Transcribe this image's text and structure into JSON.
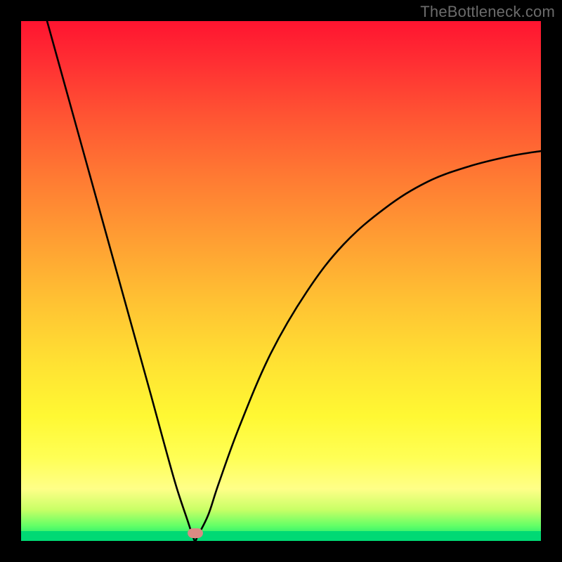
{
  "watermark": {
    "text": "TheBottleneck.com"
  },
  "chart_data": {
    "type": "line",
    "title": "",
    "xlabel": "",
    "ylabel": "",
    "xlim": [
      0,
      100
    ],
    "ylim": [
      0,
      100
    ],
    "grid": false,
    "legend": false,
    "series": [
      {
        "name": "bottleneck-curve",
        "x": [
          5,
          10,
          15,
          20,
          25,
          28,
          30,
          32,
          33,
          33.5,
          34,
          36,
          38,
          42,
          48,
          55,
          62,
          70,
          78,
          86,
          94,
          100
        ],
        "values": [
          100,
          82,
          64,
          46,
          28,
          17,
          10,
          4,
          1,
          0,
          1,
          5,
          11,
          22,
          36,
          48,
          57,
          64,
          69,
          72,
          74,
          75
        ]
      }
    ],
    "annotations": [
      {
        "name": "optimal-point",
        "x": 33.5,
        "y": 1.5,
        "shape": "pill",
        "color": "#d98b84"
      }
    ],
    "background_gradient": {
      "direction": "vertical",
      "stops": [
        {
          "pos": 0,
          "color": "#ff1430"
        },
        {
          "pos": 50,
          "color": "#ffb833"
        },
        {
          "pos": 80,
          "color": "#fff84a"
        },
        {
          "pos": 100,
          "color": "#00d974"
        }
      ]
    }
  }
}
